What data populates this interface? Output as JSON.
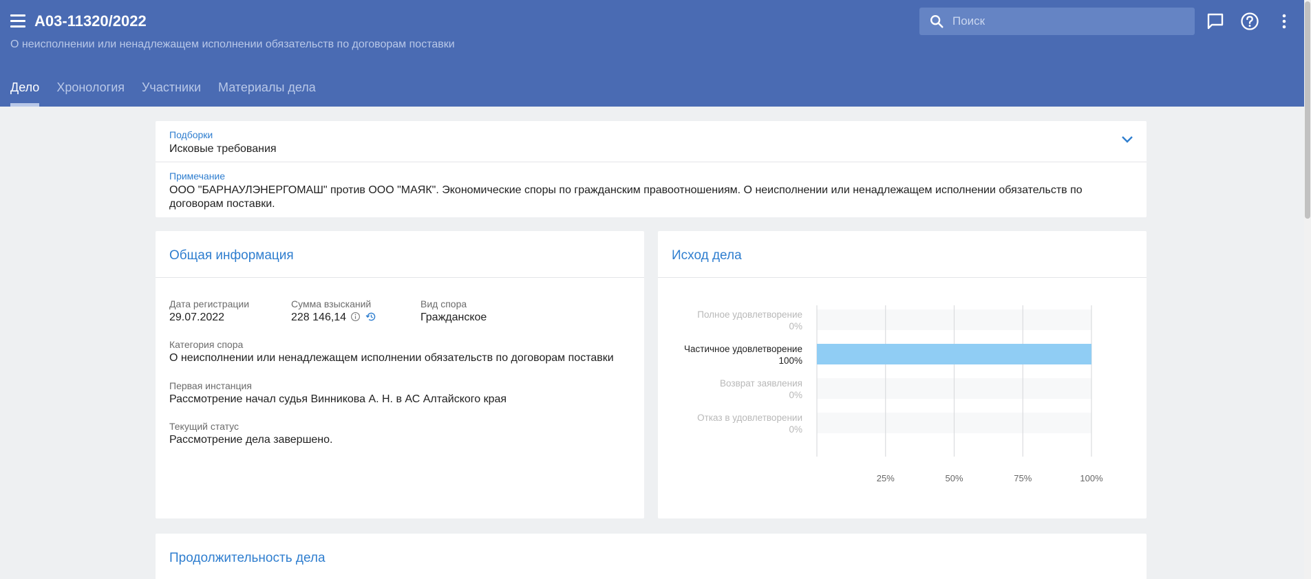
{
  "header": {
    "case_number": "А03-11320/2022",
    "subtitle": "О неисполнении или ненадлежащем исполнении обязательств по договорам поставки",
    "search_placeholder": "Поиск",
    "icons": [
      "menu-icon",
      "search-icon",
      "chat-icon",
      "help-icon",
      "more-vertical-icon"
    ],
    "accent_color": "#4a6bb3"
  },
  "tabs": [
    {
      "label": "Дело",
      "active": true
    },
    {
      "label": "Хронология",
      "active": false
    },
    {
      "label": "Участники",
      "active": false
    },
    {
      "label": "Материалы дела",
      "active": false
    }
  ],
  "collections": {
    "label": "Подборки",
    "value": "Исковые требования"
  },
  "note": {
    "label": "Примечание",
    "value": "ООО \"БАРНАУЛЭНЕРГОМАШ\" против ООО \"МАЯК\". Экономические споры по гражданским правоотношениям. О неисполнении или ненадлежащем исполнении обязательств по договорам поставки."
  },
  "general_info": {
    "title": "Общая информация",
    "reg_date_label": "Дата регистрации",
    "reg_date": "29.07.2022",
    "sum_label": "Сумма взысканий",
    "sum": "228 146,14",
    "dispute_type_label": "Вид спора",
    "dispute_type": "Гражданское",
    "category_label": "Категория спора",
    "category": "О неисполнении или ненадлежащем исполнении обязательств по договорам поставки",
    "first_instance_label": "Первая инстанция",
    "first_instance": "Рассмотрение начал судья Винникова А. Н. в АС Алтайского края",
    "status_label": "Текущий статус",
    "status": "Рассмотрение дела завершено."
  },
  "outcome": {
    "title": "Исход дела"
  },
  "duration": {
    "title": "Продолжительность дела"
  },
  "chart_data": {
    "type": "bar",
    "orientation": "horizontal",
    "title": "Исход дела",
    "categories": [
      "Полное удовлетворение",
      "Частичное удовлетворение",
      "Возврат заявления",
      "Отказ в удовлетворении"
    ],
    "value_labels": [
      "0%",
      "100%",
      "0%",
      "0%"
    ],
    "values": [
      0,
      100,
      0,
      0
    ],
    "xticks": [
      "25%",
      "50%",
      "75%",
      "100%"
    ],
    "xlim": [
      0,
      100
    ],
    "grid": true,
    "bar_color": "#90cdf4"
  }
}
